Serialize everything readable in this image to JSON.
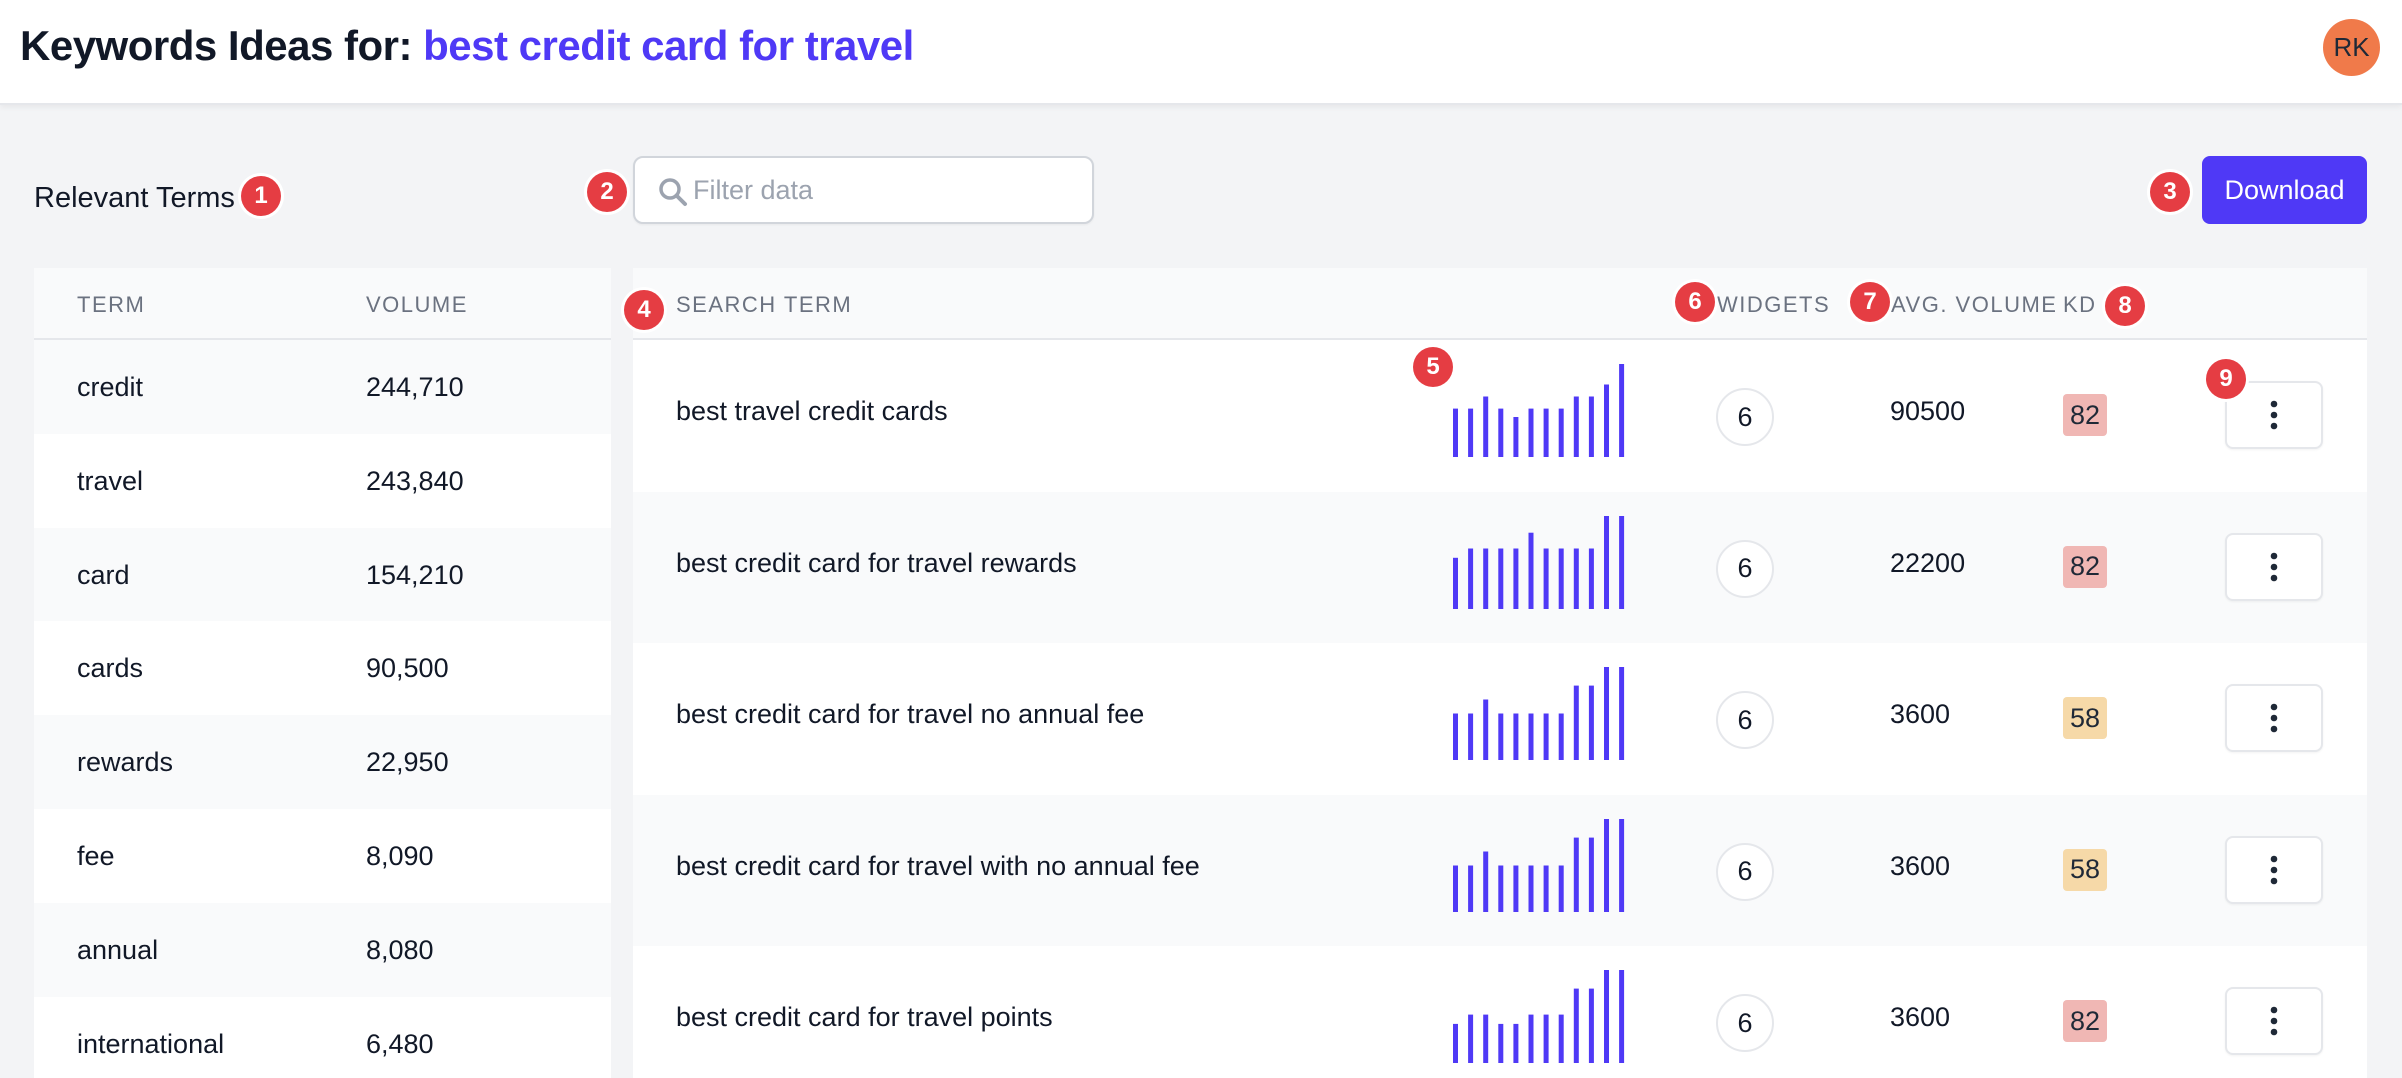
{
  "header": {
    "title_prefix": "Keywords Ideas for: ",
    "query": "best credit card for travel",
    "avatar_initials": "RK"
  },
  "toolbar": {
    "relevant_label": "Relevant Terms",
    "search_placeholder": "Filter data",
    "search_value": "",
    "download_label": "Download"
  },
  "annotations": [
    "1",
    "2",
    "3",
    "4",
    "5",
    "6",
    "7",
    "8",
    "9"
  ],
  "relevant_terms": {
    "columns": [
      "TERM",
      "VOLUME"
    ],
    "rows": [
      {
        "term": "credit",
        "volume": "244,710"
      },
      {
        "term": "travel",
        "volume": "243,840"
      },
      {
        "term": "card",
        "volume": "154,210"
      },
      {
        "term": "cards",
        "volume": "90,500"
      },
      {
        "term": "rewards",
        "volume": "22,950"
      },
      {
        "term": "fee",
        "volume": "8,090"
      },
      {
        "term": "annual",
        "volume": "8,080"
      },
      {
        "term": "international",
        "volume": "6,480"
      }
    ]
  },
  "keywords": {
    "columns": {
      "term": "SEARCH TERM",
      "widgets": "WIDGETS",
      "avg_volume": "AVG. VOLUME",
      "kd": "KD"
    },
    "rows": [
      {
        "term": "best travel credit cards",
        "widgets": "6",
        "avg_volume": "90500",
        "kd": "82",
        "kd_color": "#f0b7b4",
        "trend": [
          0.52,
          0.52,
          0.65,
          0.52,
          0.43,
          0.52,
          0.52,
          0.52,
          0.65,
          0.65,
          0.78,
          1.0
        ]
      },
      {
        "term": "best credit card for travel rewards",
        "widgets": "6",
        "avg_volume": "22200",
        "kd": "82",
        "kd_color": "#f0b7b4",
        "trend": [
          0.55,
          0.65,
          0.65,
          0.65,
          0.65,
          0.82,
          0.65,
          0.65,
          0.65,
          0.65,
          1.0,
          1.0
        ]
      },
      {
        "term": "best credit card for travel no annual fee",
        "widgets": "6",
        "avg_volume": "3600",
        "kd": "58",
        "kd_color": "#f6d9a8",
        "trend": [
          0.5,
          0.5,
          0.65,
          0.5,
          0.5,
          0.5,
          0.5,
          0.5,
          0.8,
          0.8,
          1.0,
          1.0
        ]
      },
      {
        "term": "best credit card for travel with no annual fee",
        "widgets": "6",
        "avg_volume": "3600",
        "kd": "58",
        "kd_color": "#f6d9a8",
        "trend": [
          0.5,
          0.5,
          0.65,
          0.5,
          0.5,
          0.5,
          0.5,
          0.5,
          0.8,
          0.8,
          1.0,
          1.0
        ]
      },
      {
        "term": "best credit card for travel points",
        "widgets": "6",
        "avg_volume": "3600",
        "kd": "82",
        "kd_color": "#f0b7b4",
        "trend": [
          0.42,
          0.52,
          0.52,
          0.42,
          0.42,
          0.52,
          0.52,
          0.52,
          0.8,
          0.8,
          1.0,
          1.0
        ]
      }
    ]
  },
  "colors": {
    "accent": "#4f39f6",
    "badge": "#e53d43",
    "avatar": "#f07a4a"
  }
}
